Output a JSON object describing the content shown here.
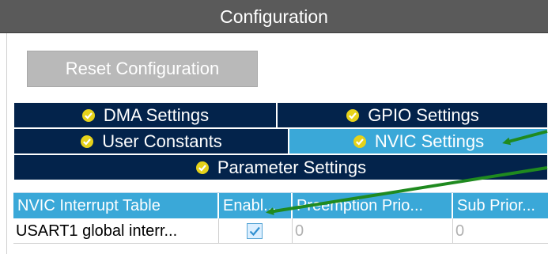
{
  "window": {
    "title": "Configuration"
  },
  "reset_button": {
    "label": "Reset Configuration"
  },
  "tabs": [
    {
      "label": "DMA Settings",
      "icon": "check-circle-icon",
      "active": false
    },
    {
      "label": "GPIO Settings",
      "icon": "check-circle-icon",
      "active": false
    },
    {
      "label": "User Constants",
      "icon": "check-circle-icon",
      "active": false
    },
    {
      "label": "NVIC Settings",
      "icon": "check-circle-icon",
      "active": true
    },
    {
      "label": "Parameter Settings",
      "icon": "check-circle-icon",
      "active": false
    }
  ],
  "nvic_table": {
    "columns": [
      "NVIC Interrupt Table",
      "Enabl...",
      "Preemption Prio...",
      "Sub Prior..."
    ],
    "rows": [
      {
        "interrupt": "USART1 global interr...",
        "enabled": true,
        "preemption_priority": "0",
        "sub_priority": "0"
      }
    ]
  },
  "colors": {
    "title_bar": "#5a5a5a",
    "tab_bg": "#03234b",
    "tab_active": "#3aa8d8",
    "check_icon": "#e6d21a",
    "annotation_arrow": "#1f8a1f"
  }
}
